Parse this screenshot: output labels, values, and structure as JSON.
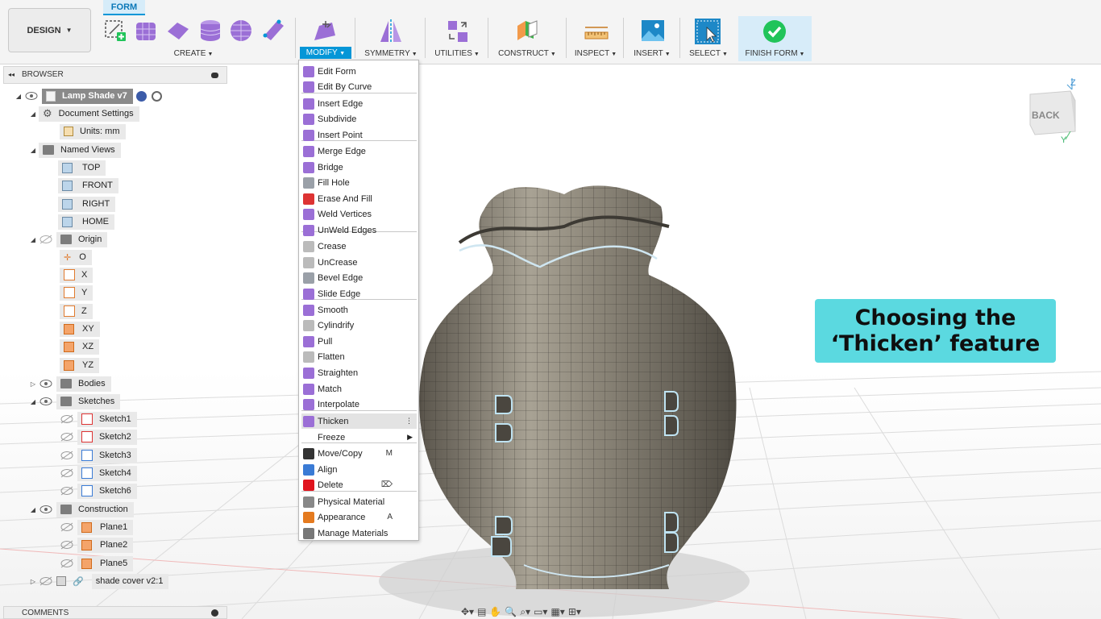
{
  "toolbar": {
    "workspace_label": "DESIGN",
    "active_tab": "FORM",
    "groups": {
      "create": "CREATE",
      "modify": "MODIFY",
      "symmetry": "SYMMETRY",
      "utilities": "UTILITIES",
      "construct": "CONSTRUCT",
      "inspect": "INSPECT",
      "insert": "INSERT",
      "select": "SELECT",
      "finish_form": "FINISH FORM"
    },
    "caret": "▾"
  },
  "browser": {
    "title": "BROWSER",
    "root": "Lamp Shade v7",
    "document_settings": "Document Settings",
    "units": "Units: mm",
    "named_views": "Named Views",
    "views": [
      "TOP",
      "FRONT",
      "RIGHT",
      "HOME"
    ],
    "origin": "Origin",
    "origin_items": [
      "O",
      "X",
      "Y",
      "Z",
      "XY",
      "XZ",
      "YZ"
    ],
    "bodies": "Bodies",
    "sketches": "Sketches",
    "sketch_items": [
      "Sketch1",
      "Sketch2",
      "Sketch3",
      "Sketch4",
      "Sketch6"
    ],
    "construction": "Construction",
    "construction_items": [
      "Plane1",
      "Plane2",
      "Plane5"
    ],
    "component": "shade cover v2:1"
  },
  "modify_menu": {
    "items": [
      "Edit Form",
      "Edit By Curve",
      "Insert Edge",
      "Subdivide",
      "Insert Point",
      "Merge Edge",
      "Bridge",
      "Fill Hole",
      "Erase And Fill",
      "Weld Vertices",
      "UnWeld Edges",
      "Crease",
      "UnCrease",
      "Bevel Edge",
      "Slide Edge",
      "Smooth",
      "Cylindrify",
      "Pull",
      "Flatten",
      "Straighten",
      "Match",
      "Interpolate",
      "Thicken",
      "Freeze",
      "Move/Copy",
      "Align",
      "Delete",
      "Physical Material",
      "Appearance",
      "Manage Materials"
    ],
    "shortcuts": {
      "move_copy": "M",
      "appearance": "A",
      "delete": "⌦"
    },
    "highlighted": "Thicken",
    "more_dots": "⋮",
    "submenu_arrow": "▶"
  },
  "caption": {
    "line1": "Choosing the",
    "line2": "‘Thicken’ feature"
  },
  "viewcube": {
    "face_label": "BACK",
    "axis_z": "Z",
    "axis_y": "Y"
  },
  "comments": {
    "title": "COMMENTS"
  },
  "colors": {
    "accent": "#0696d7",
    "caption_bg": "#5bd9e0",
    "form_icon": "#9b6fd6",
    "finish_check": "#21c45a"
  }
}
